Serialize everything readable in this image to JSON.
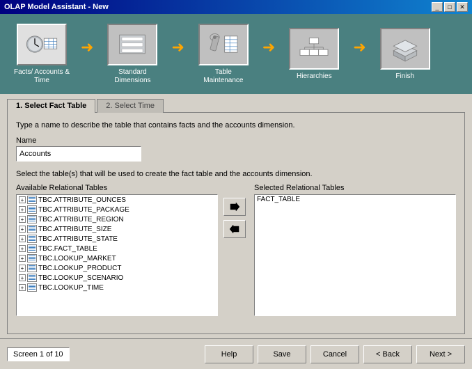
{
  "titleBar": {
    "title": "OLAP Model Assistant - New",
    "buttons": [
      "_",
      "□",
      "✕"
    ]
  },
  "wizardSteps": [
    {
      "id": "facts",
      "label": "Facts/ Accounts &\nTime",
      "active": true
    },
    {
      "id": "standard",
      "label": "Standard\nDimensions",
      "active": false
    },
    {
      "id": "table",
      "label": "Table\nMaintenance",
      "active": false
    },
    {
      "id": "hierarchies",
      "label": "Hierarchies",
      "active": false
    },
    {
      "id": "finish",
      "label": "Finish",
      "active": false
    }
  ],
  "tabs": [
    {
      "id": "tab1",
      "label": "1. Select Fact Table",
      "active": true
    },
    {
      "id": "tab2",
      "label": "2. Select Time",
      "active": false
    }
  ],
  "description": "Type a name to describe the table that contains facts and the accounts dimension.",
  "nameField": {
    "label": "Name",
    "value": "Accounts"
  },
  "selectDescription": "Select the table(s) that will be used to create the fact table and the accounts dimension.",
  "availableTablesLabel": "Available Relational Tables",
  "selectedTablesLabel": "Selected Relational Tables",
  "availableTables": [
    "TBC.ATTRIBUTE_OUNCES",
    "TBC.ATTRIBUTE_PACKAGE",
    "TBC.ATTRIBUTE_REGION",
    "TBC.ATTRIBUTE_SIZE",
    "TBC.ATTRIBUTE_STATE",
    "TBC.FACT_TABLE",
    "TBC.LOOKUP_MARKET",
    "TBC.LOOKUP_PRODUCT",
    "TBC.LOOKUP_SCENARIO",
    "TBC.LOOKUP_TIME"
  ],
  "selectedTables": [
    "FACT_TABLE"
  ],
  "transferButtons": {
    "addLabel": "→",
    "removeLabel": "←"
  },
  "bottomBar": {
    "screenInfo": "Screen 1 of 10",
    "helpLabel": "Help",
    "saveLabel": "Save",
    "cancelLabel": "Cancel",
    "backLabel": "< Back",
    "nextLabel": "Next >"
  }
}
